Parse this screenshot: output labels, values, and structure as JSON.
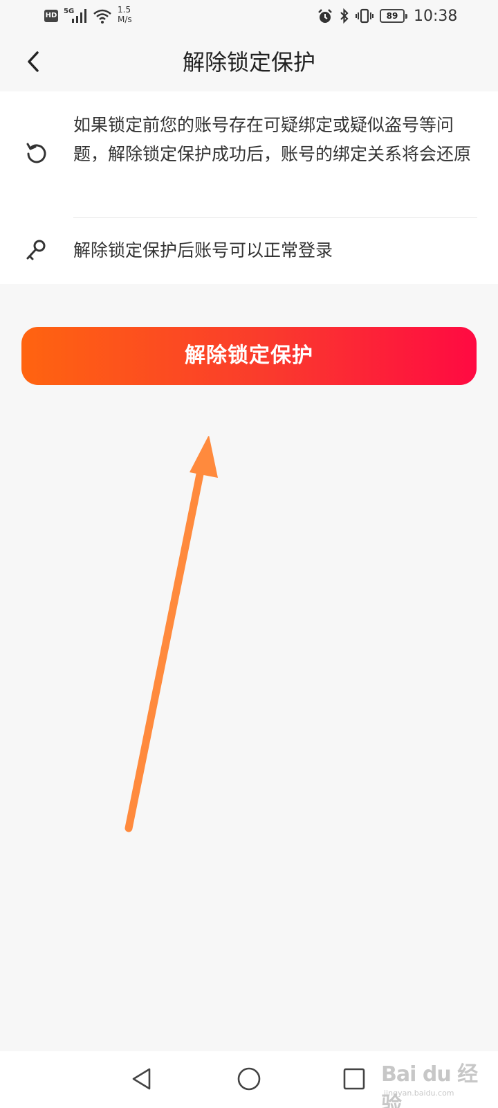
{
  "status_bar": {
    "hd": "HD",
    "network": "5G",
    "speed_value": "1.5",
    "speed_unit": "M/s",
    "battery": "89",
    "time": "10:38"
  },
  "header": {
    "title": "解除锁定保护"
  },
  "info": {
    "items": [
      {
        "icon": "refresh-icon",
        "text": "如果锁定前您的账号存在可疑绑定或疑似盗号等问题，解除锁定保护成功后，账号的绑定关系将会还原"
      },
      {
        "icon": "key-icon",
        "text": "解除锁定保护后账号可以正常登录"
      }
    ]
  },
  "action": {
    "unlock_label": "解除锁定保护"
  },
  "colors": {
    "button_start": "#ff6410",
    "button_end": "#ff0a42",
    "arrow": "#ff8a3d",
    "background": "#f7f7f7"
  },
  "watermark": {
    "logo": "Bai du 经验",
    "sub": "jingyan.baidu.com"
  }
}
